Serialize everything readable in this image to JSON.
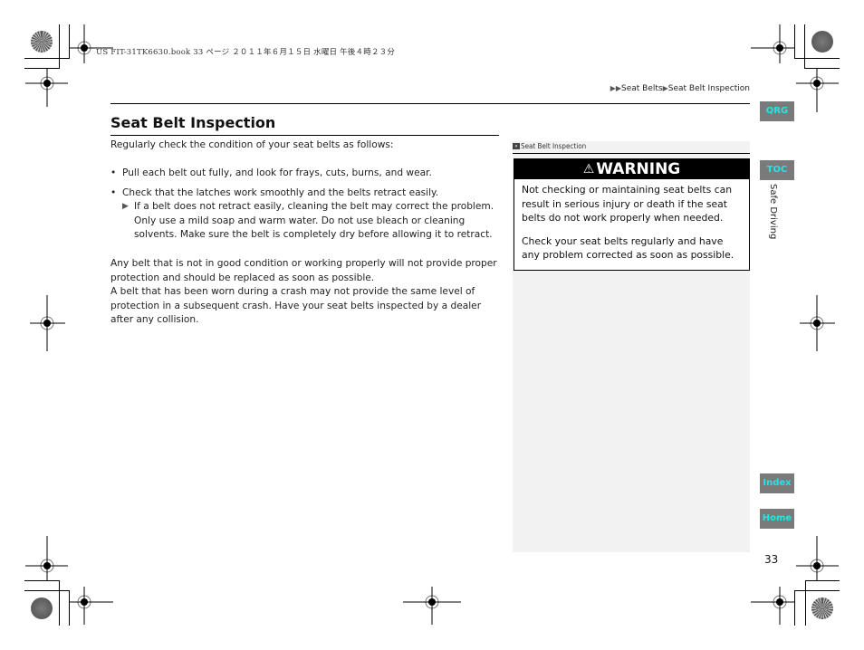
{
  "print_info": {
    "text": "US FIT-31TK6630.book  33 ページ  ２０１１年６月１５日  水曜日  午後４時２３分"
  },
  "breadcrumb": {
    "items": [
      "Seat Belts",
      "Seat Belt Inspection"
    ],
    "separator_icon": "right-triangle-icon"
  },
  "main": {
    "title": "Seat Belt Inspection",
    "intro": "Regularly check the condition of your seat belts as follows:",
    "bullets": [
      {
        "text": "Pull each belt out fully, and look for frays, cuts, burns, and wear."
      },
      {
        "text": "Check that the latches work smoothly and the belts retract easily.",
        "subnote": "If a belt does not retract easily, cleaning the belt may correct the problem. Only use a mild soap and warm water. Do not use bleach or cleaning solvents. Make sure the belt is completely dry before allowing it to retract."
      }
    ],
    "paragraphs": [
      "Any belt that is not in good condition or working properly will not provide proper protection and should be replaced as soon as possible.",
      "A belt that has been worn during a crash may not provide the same level of protection in a subsequent crash. Have your seat belts inspected by a dealer after any collision."
    ]
  },
  "sidebar": {
    "heading": "Seat Belt Inspection",
    "warning": {
      "label": "WARNING",
      "icon": "warning-triangle-icon",
      "paragraphs": [
        "Not checking or maintaining seat belts can result in serious injury or death if the seat belts do not work properly when needed.",
        "Check your seat belts regularly and have any problem corrected as soon as possible."
      ]
    }
  },
  "nav": {
    "qrg": "QRG",
    "toc": "TOC",
    "index": "Index",
    "home": "Home",
    "section_label": "Safe Driving",
    "button_bg": "#7a7a7a",
    "button_fg": "#21e6e6"
  },
  "page": {
    "number": "33"
  }
}
